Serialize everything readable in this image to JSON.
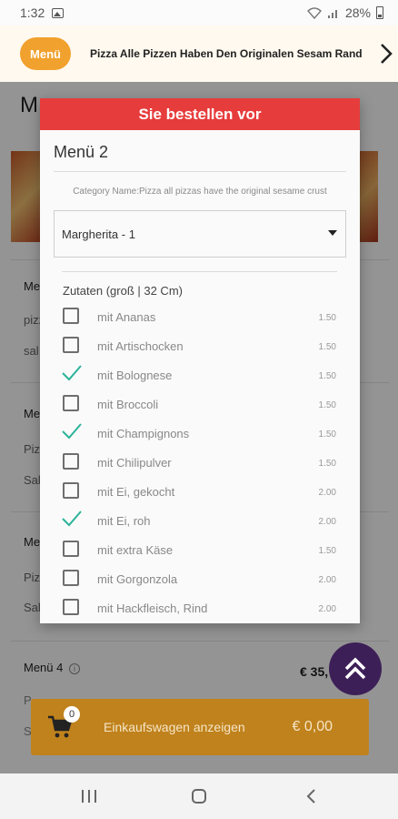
{
  "status_bar": {
    "time": "1:32",
    "battery": "28%"
  },
  "category_bar": {
    "pill_label": "Menü",
    "title": "Pizza Alle Pizzen Haben Den Originalen Sesam Rand"
  },
  "background": {
    "heading": "M",
    "cards": [
      {
        "title": "Men",
        "line1": "pizz",
        "line2": "sal"
      },
      {
        "title": "Men",
        "line1": "Pizz",
        "line2": "Sal"
      },
      {
        "title": "Men",
        "line1": "Pizz",
        "line2": "Sal"
      }
    ],
    "menu4": {
      "title": "Menü 4",
      "price": "€ 35,",
      "line1": "P",
      "line2": "S"
    }
  },
  "cart": {
    "count": "0",
    "label": "Einkaufswagen anzeigen",
    "total": "€ 0,00"
  },
  "modal": {
    "header": "Sie bestellen vor",
    "menu_name": "Menü 2",
    "category": "Category Name:Pizza all pizzas have the original sesame crust",
    "select_value": "Margherita - 1",
    "section_title": "Zutaten (groß | 32 Cm)",
    "ingredients": [
      {
        "name": "mit Ananas",
        "price": "1.50",
        "checked": false
      },
      {
        "name": "mit Artischocken",
        "price": "1.50",
        "checked": false
      },
      {
        "name": "mit Bolognese",
        "price": "1.50",
        "checked": true
      },
      {
        "name": "mit Broccoli",
        "price": "1.50",
        "checked": false
      },
      {
        "name": "mit Champignons",
        "price": "1.50",
        "checked": true
      },
      {
        "name": "mit Chilipulver",
        "price": "1.50",
        "checked": false
      },
      {
        "name": "mit Ei, gekocht",
        "price": "2.00",
        "checked": false
      },
      {
        "name": "mit Ei, roh",
        "price": "2.00",
        "checked": true
      },
      {
        "name": "mit extra Käse",
        "price": "1.50",
        "checked": false
      },
      {
        "name": "mit Gorgonzola",
        "price": "2.00",
        "checked": false
      },
      {
        "name": "mit Hackfleisch, Rind",
        "price": "2.00",
        "checked": false
      }
    ]
  },
  "colors": {
    "modal_header": "#e73c3c",
    "pill": "#f1a12d",
    "check": "#2bb39a",
    "cart": "#c0821c",
    "fab": "#3d1f57"
  }
}
